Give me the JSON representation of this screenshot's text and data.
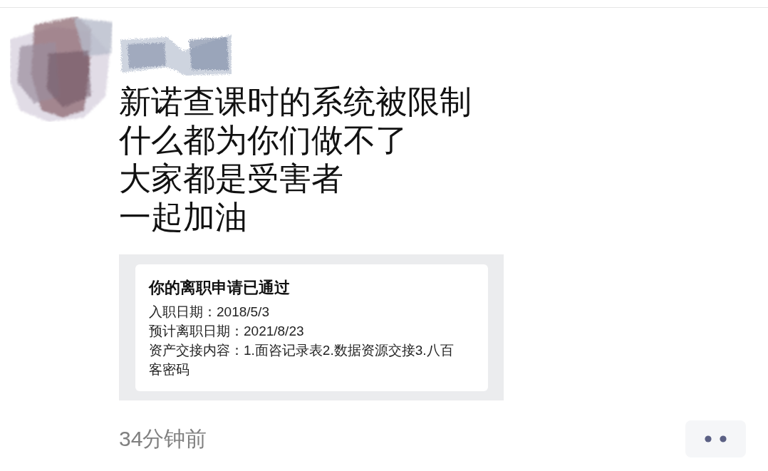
{
  "post": {
    "text_lines": [
      "新诺查课时的系统被限制",
      "什么都为你们做不了",
      "大家都是受害者",
      "一起加油"
    ],
    "shared_card": {
      "title": "你的离职申请已通过",
      "fields": [
        {
          "label": "入职日期：",
          "value": "2018/5/3"
        },
        {
          "label": "预计离职日期：",
          "value": "2021/8/23"
        },
        {
          "label": "资产交接内容：",
          "value": "1.面咨记录表2.数据资源交接3.八百客密码"
        }
      ]
    },
    "time": "34分钟前"
  }
}
